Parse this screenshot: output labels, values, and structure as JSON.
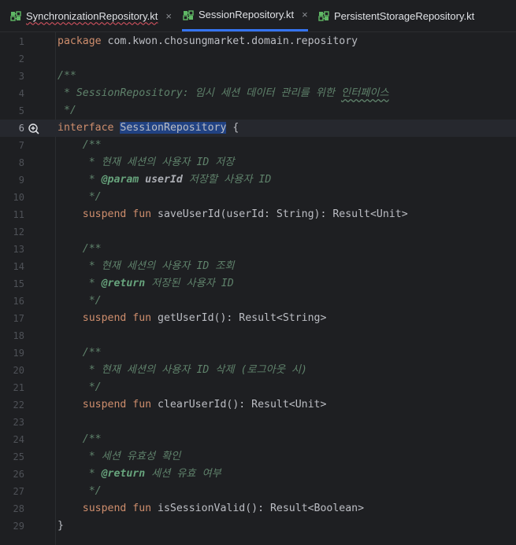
{
  "tabs": [
    {
      "label": "SynchronizationRepository.kt",
      "icon": "kotlin-interface-icon",
      "has_error": true,
      "active": false,
      "closable": true
    },
    {
      "label": "SessionRepository.kt",
      "icon": "kotlin-interface-icon",
      "has_error": false,
      "active": true,
      "closable": true
    },
    {
      "label": "PersistentStorageRepository.kt",
      "icon": "kotlin-interface-icon",
      "has_error": false,
      "active": false,
      "closable": false
    }
  ],
  "close_glyph": "×",
  "current_line": 6,
  "gutter_icon": "implementations-gutter-icon",
  "lines": [
    {
      "n": "1",
      "tokens": [
        [
          "kw",
          "package"
        ],
        [
          "",
          " com.kwon.chosungmarket.domain.repository"
        ]
      ]
    },
    {
      "n": "2",
      "tokens": []
    },
    {
      "n": "3",
      "tokens": [
        [
          "kd",
          "/**"
        ]
      ]
    },
    {
      "n": "4",
      "tokens": [
        [
          "kd",
          " * SessionRepository: 임시 세션 데이터 관리를 위한 "
        ],
        [
          "kdu",
          "인터페이스"
        ]
      ]
    },
    {
      "n": "5",
      "tokens": [
        [
          "kd",
          " */"
        ]
      ]
    },
    {
      "n": "6",
      "tokens": [
        [
          "kw",
          "interface"
        ],
        [
          "",
          " "
        ],
        [
          "sel",
          "SessionRepository"
        ],
        [
          "",
          " {"
        ]
      ]
    },
    {
      "n": "7",
      "tokens": [
        [
          "kd",
          "    /**"
        ]
      ]
    },
    {
      "n": "8",
      "tokens": [
        [
          "kd",
          "     * 현재 세션의 사용자 ID 저장"
        ]
      ]
    },
    {
      "n": "9",
      "tokens": [
        [
          "kd",
          "     * "
        ],
        [
          "tag",
          "@param"
        ],
        [
          "kd",
          " "
        ],
        [
          "param",
          "userId"
        ],
        [
          "kd",
          " 저장할 사용자 ID"
        ]
      ]
    },
    {
      "n": "10",
      "tokens": [
        [
          "kd",
          "     */"
        ]
      ]
    },
    {
      "n": "11",
      "tokens": [
        [
          "kw",
          "    suspend fun "
        ],
        [
          "",
          "saveUserId(userId: String): Result<Unit>"
        ]
      ]
    },
    {
      "n": "12",
      "tokens": []
    },
    {
      "n": "13",
      "tokens": [
        [
          "kd",
          "    /**"
        ]
      ]
    },
    {
      "n": "14",
      "tokens": [
        [
          "kd",
          "     * 현재 세션의 사용자 ID 조회"
        ]
      ]
    },
    {
      "n": "15",
      "tokens": [
        [
          "kd",
          "     * "
        ],
        [
          "tag",
          "@return"
        ],
        [
          "kd",
          " 저장된 사용자 ID"
        ]
      ]
    },
    {
      "n": "16",
      "tokens": [
        [
          "kd",
          "     */"
        ]
      ]
    },
    {
      "n": "17",
      "tokens": [
        [
          "kw",
          "    suspend fun "
        ],
        [
          "",
          "getUserId(): Result<String>"
        ]
      ]
    },
    {
      "n": "18",
      "tokens": []
    },
    {
      "n": "19",
      "tokens": [
        [
          "kd",
          "    /**"
        ]
      ]
    },
    {
      "n": "20",
      "tokens": [
        [
          "kd",
          "     * 현재 세션의 사용자 ID 삭제 (로그아웃 시)"
        ]
      ]
    },
    {
      "n": "21",
      "tokens": [
        [
          "kd",
          "     */"
        ]
      ]
    },
    {
      "n": "22",
      "tokens": [
        [
          "kw",
          "    suspend fun "
        ],
        [
          "",
          "clearUserId(): Result<Unit>"
        ]
      ]
    },
    {
      "n": "23",
      "tokens": []
    },
    {
      "n": "24",
      "tokens": [
        [
          "kd",
          "    /**"
        ]
      ]
    },
    {
      "n": "25",
      "tokens": [
        [
          "kd",
          "     * 세션 유효성 확인"
        ]
      ]
    },
    {
      "n": "26",
      "tokens": [
        [
          "kd",
          "     * "
        ],
        [
          "tag",
          "@return"
        ],
        [
          "kd",
          " 세션 유효 여부"
        ]
      ]
    },
    {
      "n": "27",
      "tokens": [
        [
          "kd",
          "     */"
        ]
      ]
    },
    {
      "n": "28",
      "tokens": [
        [
          "kw",
          "    suspend fun "
        ],
        [
          "",
          "isSessionValid(): Result<Boolean>"
        ]
      ]
    },
    {
      "n": "29",
      "tokens": [
        [
          "",
          "}"
        ]
      ]
    }
  ]
}
